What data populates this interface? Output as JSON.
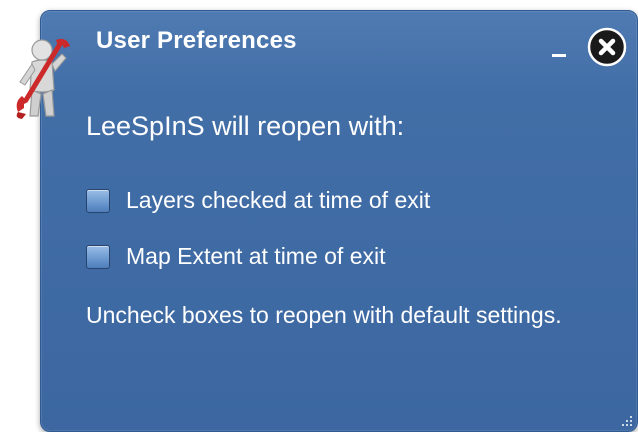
{
  "window": {
    "title": "User Preferences",
    "minimize_icon": "minimize-icon",
    "close_icon": "close-icon"
  },
  "content": {
    "heading": "LeeSpInS will reopen with:",
    "options": [
      {
        "label": "Layers checked at time of exit",
        "checked": false
      },
      {
        "label": "Map Extent at time of exit",
        "checked": false
      }
    ],
    "note": "Uncheck boxes to reopen with default settings."
  },
  "icons": {
    "app": "user-with-wrench-icon",
    "resize": "resize-grip-icon"
  },
  "colors": {
    "panel": "#3f6ba5",
    "text": "#ffffff",
    "checkbox": "#6d9ad0",
    "wrench": "#cc2a2a"
  }
}
